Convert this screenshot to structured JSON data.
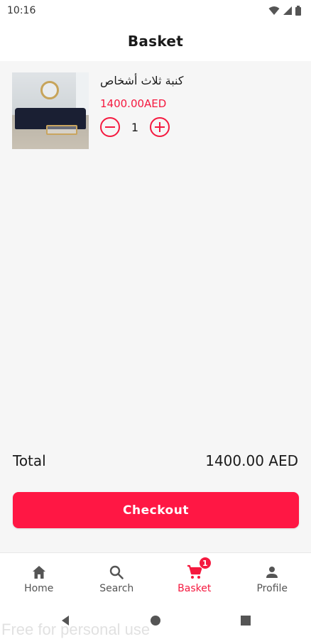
{
  "status_bar": {
    "time": "10:16"
  },
  "header": {
    "title": "Basket"
  },
  "cart": {
    "items": [
      {
        "name": "كنبة ثلاث أشخاص",
        "price": "1400.00AED",
        "quantity": "1"
      }
    ]
  },
  "summary": {
    "total_label": "Total",
    "total_value": "1400.00 AED"
  },
  "checkout": {
    "label": "Checkout"
  },
  "bottom_nav": {
    "items": [
      {
        "label": "Home",
        "icon": "home-icon"
      },
      {
        "label": "Search",
        "icon": "search-icon"
      },
      {
        "label": "Basket",
        "icon": "cart-icon",
        "badge": "1"
      },
      {
        "label": "Profile",
        "icon": "profile-icon"
      }
    ],
    "active_index": 2
  },
  "watermark": "Free for personal use",
  "colors": {
    "accent": "#f5193f",
    "checkout": "#ff1744",
    "background": "#f6f6f6"
  }
}
